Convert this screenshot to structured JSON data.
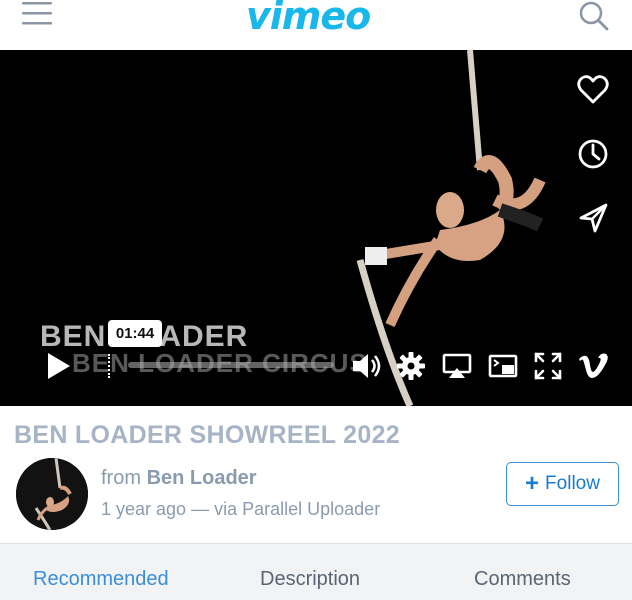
{
  "header": {
    "logo_text": "vimeo",
    "menu_icon": "hamburger-menu-icon",
    "search_icon": "search-icon"
  },
  "video": {
    "watermark_line1": "BEN LOADER",
    "watermark_line2": "BEN LOADER CIRCUS",
    "time_tooltip": "01:44",
    "side_actions": [
      "heart-icon",
      "clock-icon",
      "share-send-icon"
    ],
    "controls": [
      "play-icon",
      "volume-icon",
      "settings-icon",
      "airplay-icon",
      "picture-in-picture-icon",
      "fullscreen-icon",
      "vimeo-v-icon"
    ],
    "progress_fraction": 0.0
  },
  "info": {
    "title": "BEN LOADER SHOWREEL 2022",
    "from_prefix": "from",
    "author": "Ben Loader",
    "age": "1 year ago",
    "via_sep": "— via",
    "uploader": "Parallel Uploader",
    "follow_label": "Follow",
    "follow_plus": "+"
  },
  "tabs": [
    {
      "label": "Recommended",
      "active": true
    },
    {
      "label": "Description",
      "active": false
    },
    {
      "label": "Comments",
      "active": false
    }
  ],
  "colors": {
    "accent": "#1ab7ea",
    "link_blue": "#3b8ed6",
    "muted_text": "#8a9bb0",
    "title_text": "#a7b4c6"
  }
}
